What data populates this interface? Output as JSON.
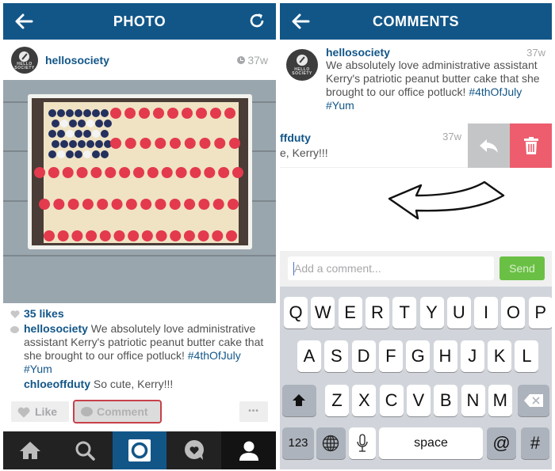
{
  "left_screen": {
    "header": {
      "title": "PHOTO",
      "back_icon": "arrow-left-icon",
      "refresh_icon": "refresh-icon"
    },
    "post": {
      "username": "hellosociety",
      "avatar_text_line1": "HELLO",
      "avatar_text_line2": "SOCIETY",
      "time_ago": "37w",
      "photo_alt": "Flag cake with blueberries and raspberries",
      "likes": "35 likes",
      "caption_user": "hellosociety",
      "caption_text": " We absolutely love administrative assistant Kerry's patriotic peanut butter cake that she brought to our office potluck! ",
      "caption_tags": "#4thOfJuly #Yum",
      "comment_user": "chloeoffduty",
      "comment_text": " So cute, Kerry!!!"
    },
    "actions": {
      "like_label": "Like",
      "comment_label": "Comment",
      "more_label": "•••"
    },
    "tabbar": [
      "home",
      "explore",
      "camera",
      "activity",
      "profile"
    ]
  },
  "right_screen": {
    "header": {
      "title": "COMMENTS"
    },
    "caption_comment": {
      "username": "hellosociety",
      "time_ago": "37w",
      "text": "We absolutely love administrative assistant Kerry's patriotic peanut butter cake that she brought to our office potluck! ",
      "tags": "#4thOfJuly #Yum"
    },
    "swiped_comment": {
      "username_visible": "ffduty",
      "text_visible": "e, Kerry!!!",
      "time_ago": "37w",
      "reply_icon": "reply-icon",
      "delete_icon": "trash-icon"
    },
    "compose": {
      "placeholder": "Add a comment...",
      "send_label": "Send"
    },
    "keyboard": {
      "row1": [
        "Q",
        "W",
        "E",
        "R",
        "T",
        "Y",
        "U",
        "I",
        "O",
        "P"
      ],
      "row2": [
        "A",
        "S",
        "D",
        "F",
        "G",
        "H",
        "J",
        "K",
        "L"
      ],
      "row3": [
        "Z",
        "X",
        "C",
        "V",
        "B",
        "N",
        "M"
      ],
      "numbers_label": "123",
      "space_label": "space",
      "at_label": "@",
      "hash_label": "#"
    }
  },
  "colors": {
    "brand_blue": "#125688",
    "send_green": "#6ac045",
    "delete_red": "#ed5d6e",
    "highlight_red": "#c7414b"
  }
}
